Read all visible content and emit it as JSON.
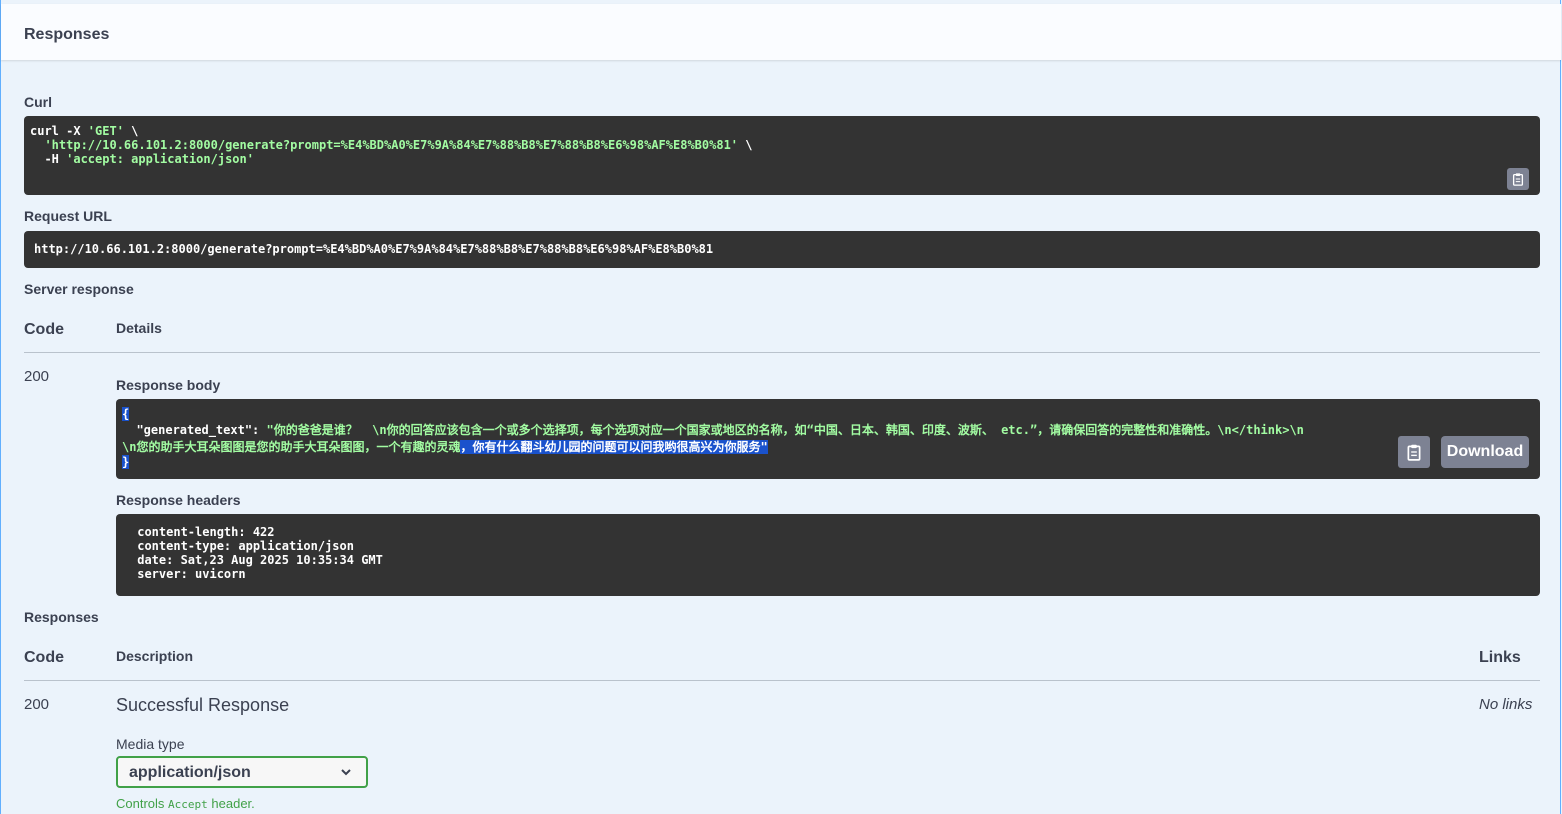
{
  "responses_header": {
    "title": "Responses"
  },
  "curl": {
    "label": "Curl",
    "line1_prefix": "curl -X ",
    "line1_method": "'GET'",
    "line1_suffix": " \\",
    "line2_url": "  'http://10.66.101.2:8000/generate?prompt=%E4%BD%A0%E7%9A%84%E7%88%B8%E7%88%B8%E6%98%AF%E8%B0%81'",
    "line2_suffix": " \\",
    "line3_prefix": "  -H ",
    "line3_header": "'accept: application/json'"
  },
  "request_url": {
    "label": "Request URL",
    "value": "http://10.66.101.2:8000/generate?prompt=%E4%BD%A0%E7%9A%84%E7%88%B8%E7%88%B8%E6%98%AF%E8%B0%81"
  },
  "server_response": {
    "label": "Server response",
    "col_code": "Code",
    "col_details": "Details",
    "code": "200",
    "body_label": "Response body",
    "body_open": "{",
    "body_key": "  \"generated_text\": ",
    "body_value_line1": "\"你的爸爸是谁？  \\n你的回答应该包含一个或多个选择项，每个选项对应一个国家或地区的名称，如“中国、日本、韩国、印度、波斯、 etc.”，请确保回答的完整性和准确性。\\n</think>\\n",
    "body_value_line2_plain": "\\n您的助手大耳朵图图是您的助手大耳朵图图，一个有趣的灵魂",
    "body_value_line2_selected": "，你有什么翻斗幼儿园的问题可以问我哟很高兴为你服务\"",
    "body_close": "}",
    "download_label": "Download",
    "headers_label": "Response headers",
    "headers": [
      " content-length: 422",
      " content-type: application/json",
      " date: Sat,23 Aug 2025 10:35:34 GMT",
      " server: uvicorn"
    ]
  },
  "responses": {
    "label": "Responses",
    "col_code": "Code",
    "col_description": "Description",
    "col_links": "Links",
    "code": "200",
    "description": "Successful Response",
    "links": "No links",
    "media_type_label": "Media type",
    "media_type_value": "application/json",
    "controls_prefix": "Controls ",
    "controls_code": "Accept",
    "controls_suffix": " header."
  },
  "icons": {
    "copy": "clipboard-copy-icon",
    "chevron": "chevron-down-icon"
  },
  "colors": {
    "accent_blue": "#61affe",
    "code_bg": "#333333",
    "string_green": "#a2fca2",
    "select_green": "#41a148"
  }
}
